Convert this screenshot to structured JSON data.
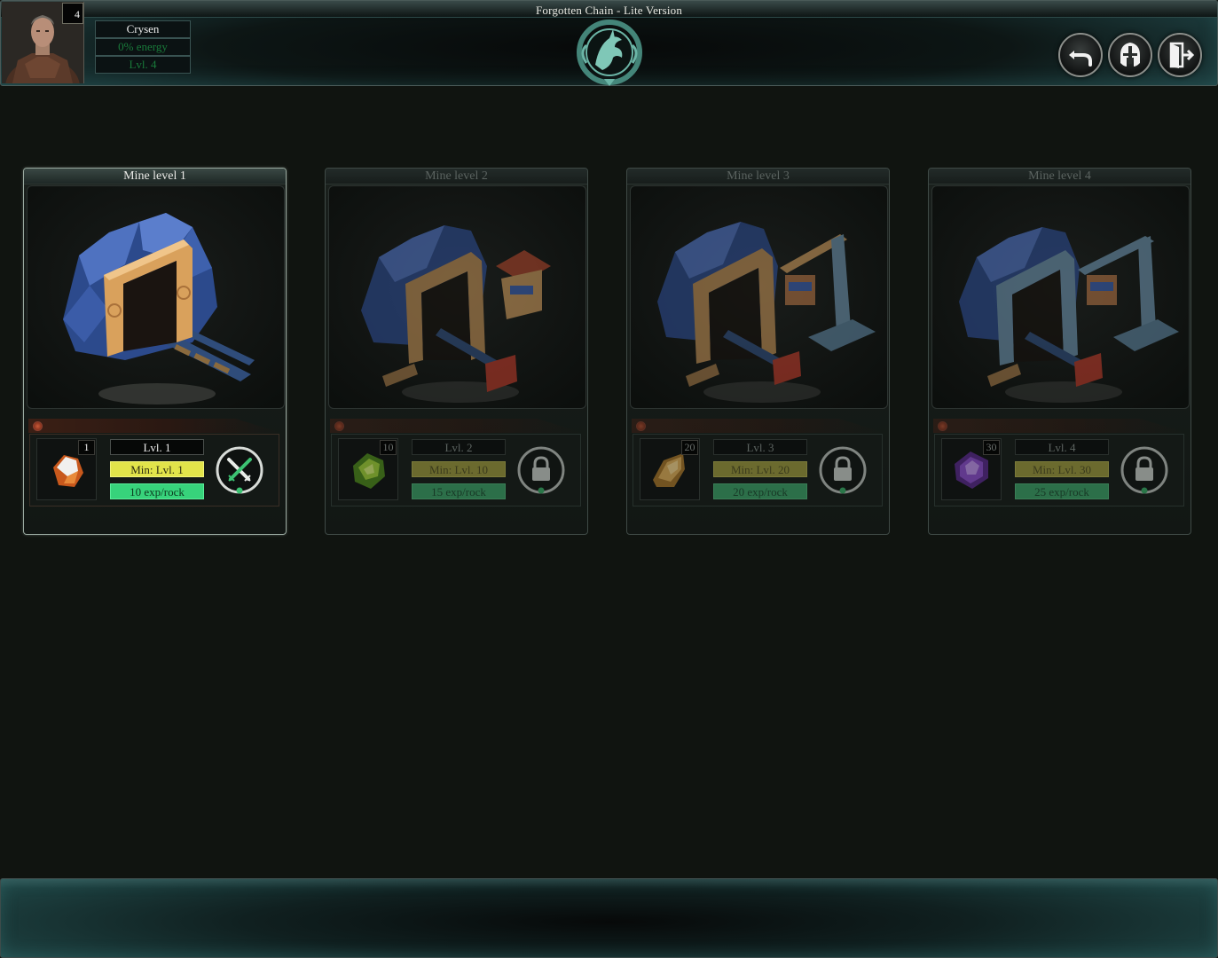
{
  "header": {
    "title": "Forgotten Chain - Lite Version",
    "player": {
      "level_badge": "4",
      "name": "Crysen",
      "energy": "0% energy",
      "level": "Lvl. 4"
    },
    "emblem_icon": "dragon-emblem-icon",
    "buttons": [
      {
        "name": "back-button",
        "icon": "back-arrow-icon"
      },
      {
        "name": "character-button",
        "icon": "helmet-icon"
      },
      {
        "name": "logout-button",
        "icon": "exit-door-icon"
      }
    ]
  },
  "mines": [
    {
      "title": "Mine level 1",
      "locked": false,
      "ore_count": "1",
      "level": "Lvl. 1",
      "min_level": "Min: Lvl. 1",
      "exp": "10 exp/rock",
      "ore_icon": "white-orange-ore-icon",
      "action_icon": "crossed-swords-icon"
    },
    {
      "title": "Mine level 2",
      "locked": true,
      "ore_count": "10",
      "level": "Lvl. 2",
      "min_level": "Min: Lvl. 10",
      "exp": "15 exp/rock",
      "ore_icon": "green-ore-icon",
      "action_icon": "lock-icon"
    },
    {
      "title": "Mine level 3",
      "locked": true,
      "ore_count": "20",
      "level": "Lvl. 3",
      "min_level": "Min: Lvl. 20",
      "exp": "20 exp/rock",
      "ore_icon": "gold-ore-icon",
      "action_icon": "lock-icon"
    },
    {
      "title": "Mine level 4",
      "locked": true,
      "ore_count": "30",
      "level": "Lvl. 4",
      "min_level": "Min: Lvl. 30",
      "exp": "25 exp/rock",
      "ore_icon": "purple-ore-icon",
      "action_icon": "lock-icon"
    }
  ],
  "colors": {
    "background": "#101410",
    "frame_teal": "#1f4244",
    "min_level_yellow": "#e2e44a",
    "exp_green": "#37d37b",
    "energy_text": "#197a3a"
  }
}
